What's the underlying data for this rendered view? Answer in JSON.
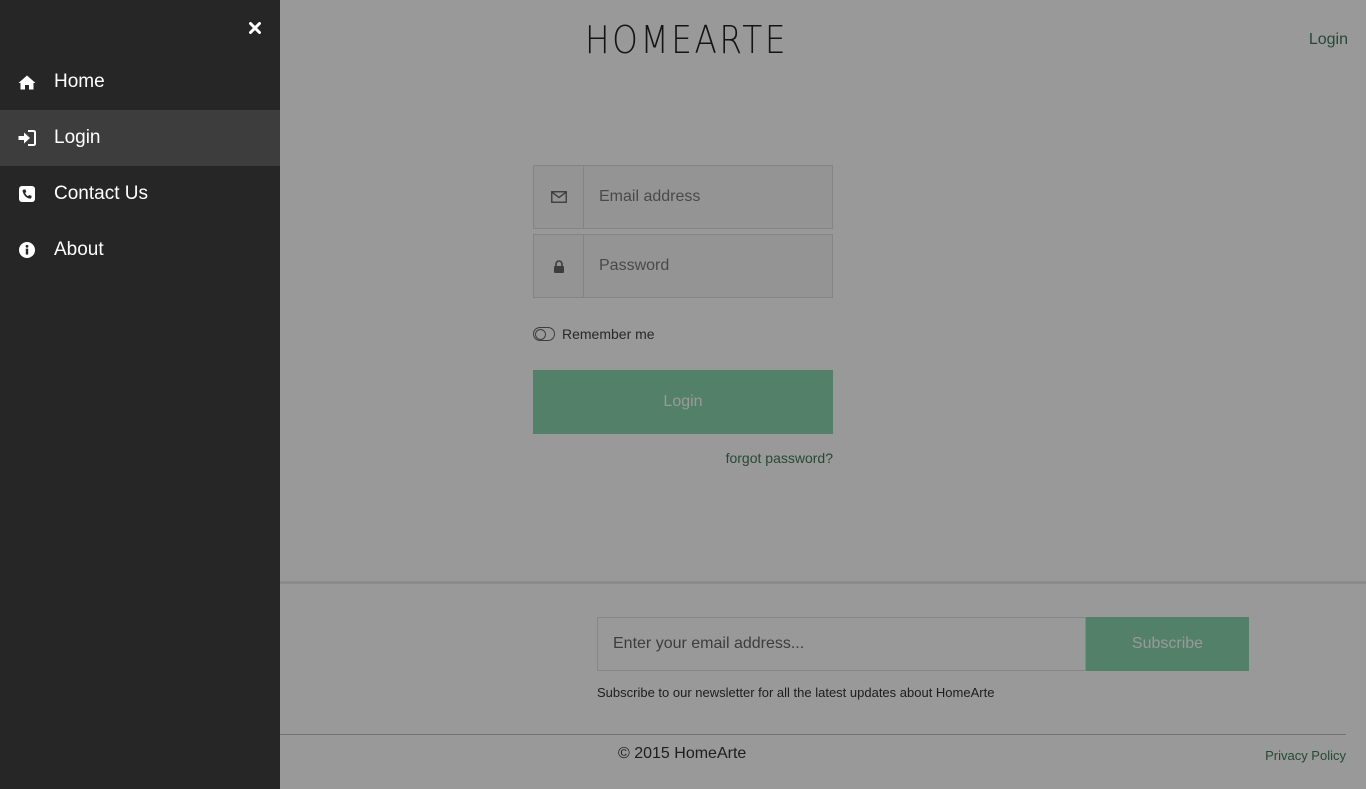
{
  "header": {
    "logo_text": "HOMEARTE",
    "login_link": "Login"
  },
  "login_form": {
    "email_placeholder": "Email address",
    "password_placeholder": "Password",
    "remember_label": "Remember me",
    "remember_checked": false,
    "login_button": "Login",
    "forgot_link": "forgot password?"
  },
  "newsletter": {
    "email_placeholder": "Enter your email address...",
    "subscribe_button": "Subscribe",
    "note": "Subscribe to our newsletter for all the latest updates about HomeArte"
  },
  "footer": {
    "copyright": "© 2015 HomeArte",
    "privacy_link": "Privacy Policy"
  },
  "sidebar": {
    "close_icon": "close-icon",
    "items": [
      {
        "label": "Home",
        "icon": "home-icon",
        "active": false
      },
      {
        "label": "Login",
        "icon": "sign-in-icon",
        "active": true
      },
      {
        "label": "Contact Us",
        "icon": "phone-icon",
        "active": false
      },
      {
        "label": "About",
        "icon": "info-icon",
        "active": false
      }
    ]
  },
  "colors": {
    "accent": "#8ad6b0",
    "link": "#3f7a5f",
    "sidebar_bg": "#262626",
    "sidebar_active": "#3d3d3d"
  }
}
